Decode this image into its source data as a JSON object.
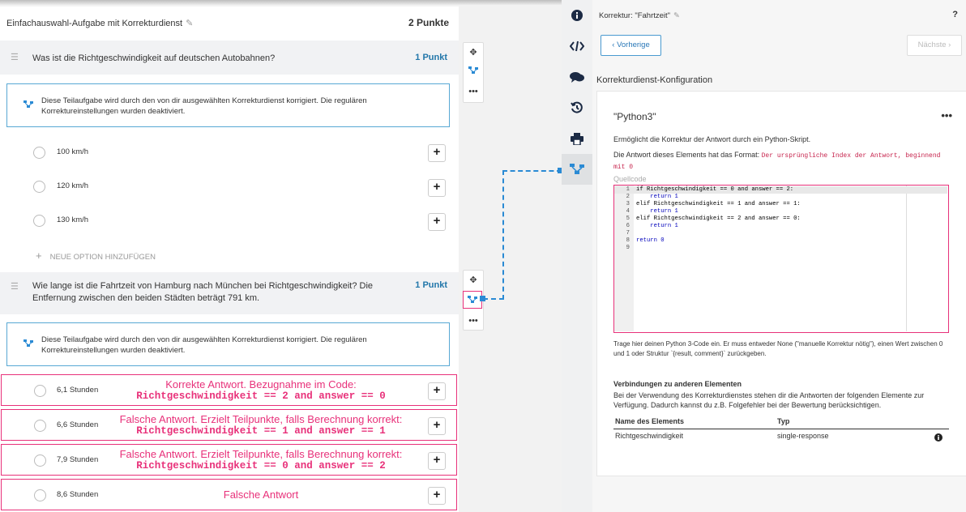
{
  "editor": {
    "title": "Einfachauswahl-Aufgabe mit Korrekturdienst",
    "points": "2 Punkte",
    "question1": {
      "text": "Was ist die Richtgeschwindigkeit auf deutschen Autobahnen?",
      "points": "1 Punkt",
      "info": "Diese Teilaufgabe wird durch den von dir ausgewählten Korrekturdienst korrigiert. Die regulären Korrektureinstellungen wurden deaktiviert.",
      "options": [
        "100 km/h",
        "120 km/h",
        "130 km/h"
      ],
      "add_option": "NEUE OPTION HINZUFÜGEN"
    },
    "question2": {
      "text": "Wie lange ist die Fahrtzeit von Hamburg nach München bei Richtgeschwindigkeit? Die Entfernung zwischen den beiden Städten beträgt 791 km.",
      "points": "1 Punkt",
      "info": "Diese Teilaufgabe wird durch den von dir ausgewählten Korrekturdienst korrigiert. Die regulären Korrektureinstellungen wurden deaktiviert.",
      "options": [
        {
          "label": "6,1 Stunden",
          "note": "Korrekte Antwort. Bezugnahme im Code:",
          "code": "Richtgeschwindigkeit == 2 and answer == 0"
        },
        {
          "label": "6,6 Stunden",
          "note": "Falsche Antwort. Erzielt Teilpunkte, falls Berechnung korrekt:",
          "code": "Richtgeschwindigkeit == 1 and answer == 1"
        },
        {
          "label": "7,9 Stunden",
          "note": "Falsche Antwort. Erzielt Teilpunkte, falls Berechnung korrekt:",
          "code": "Richtgeschwindigkeit == 0 and answer == 2"
        },
        {
          "label": "8,6 Stunden",
          "note": "Falsche Antwort",
          "code": ""
        }
      ]
    }
  },
  "panel": {
    "title": "Korrektur: \"Fahrtzeit\"",
    "help": "?",
    "prev": "Vorherige",
    "next": "Nächste",
    "section": "Korrekturdienst-Konfiguration",
    "card": {
      "title": "\"Python3\"",
      "desc": "Ermöglicht die Korrektur der Antwort durch ein Python-Skript.",
      "format_label": "Die Antwort dieses Elements hat das Format:",
      "format_code": "Der ursprüngliche Index der Antwort, beginnend mit 0",
      "source_label": "Quellcode",
      "code_lines": [
        {
          "n": "1",
          "t": "if Richtgeschwindigkeit == 0 and answer == 2:"
        },
        {
          "n": "2",
          "t": "    return 1"
        },
        {
          "n": "3",
          "t": "elif Richtgeschwindigkeit == 1 and answer == 1:"
        },
        {
          "n": "4",
          "t": "    return 1"
        },
        {
          "n": "5",
          "t": "elif Richtgeschwindigkeit == 2 and answer == 0:"
        },
        {
          "n": "6",
          "t": "    return 1"
        },
        {
          "n": "7",
          "t": ""
        },
        {
          "n": "8",
          "t": "return 0"
        },
        {
          "n": "9",
          "t": ""
        }
      ],
      "help": "Trage hier deinen Python 3-Code ein. Er muss entweder None (\"manuelle Korrektur nötig\"), einen Wert zwischen 0 und 1 oder Struktur `{result, comment}` zurückgeben.",
      "connections_heading": "Verbindungen zu anderen Elementen",
      "connections_desc": "Bei der Verwendung des Korrekturdienstes stehen dir die Antworten der folgenden Elemente zur Verfügung. Dadurch kannst du z.B. Folgefehler bei der Bewertung berücksichtigen.",
      "table": {
        "headers": [
          "Name des Elements",
          "Typ"
        ],
        "rows": [
          [
            "Richtgeschwindigkeit",
            "single-response"
          ]
        ]
      }
    }
  },
  "colors": {
    "accent": "#2a8ad4",
    "annotation": "#e8317a",
    "sidebar_icon": "#1b2a44"
  }
}
